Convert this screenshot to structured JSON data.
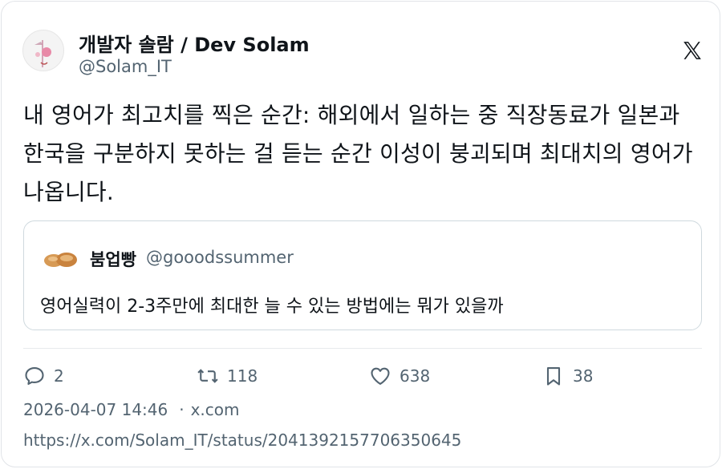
{
  "author": {
    "name": "개발자 솔람 / Dev Solam",
    "handle": "@Solam_IT"
  },
  "tweet": {
    "text": "내 영어가 최고치를 찍은 순간: 해외에서 일하는 중 직장동료가 일본과 한국을 구분하지 못하는 걸 듣는 순간 이성이 붕괴되며 최대치의 영어가 나옵니다."
  },
  "quote": {
    "name": "붐업빵",
    "handle": "@gooodssummer",
    "text": "영어실력이 2-3주만에 최대한 늘 수 있는 방법에는 뭐가 있을까"
  },
  "actions": {
    "replies": "2",
    "reposts": "118",
    "likes": "638",
    "bookmarks": "38"
  },
  "meta": {
    "timestamp": "2026-04-07 14:46",
    "separator": "·",
    "source": "x.com",
    "url": "https://x.com/Solam_IT/status/2041392157706350645"
  },
  "icons": {
    "platform": "x-logo-icon",
    "reply": "comment-icon",
    "repost": "repost-icon",
    "like": "heart-icon",
    "bookmark": "bookmark-icon"
  },
  "colors": {
    "text": "#0f1419",
    "secondary": "#536471",
    "border": "#cfd9de"
  }
}
